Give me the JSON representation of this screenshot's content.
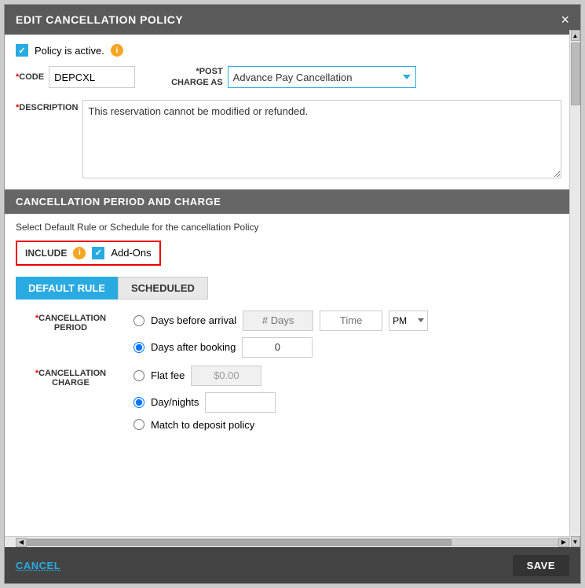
{
  "dialog": {
    "title": "EDIT CANCELLATION POLICY",
    "close_label": "×"
  },
  "form": {
    "policy_active_label": "Policy is active.",
    "code_label": "*CODE",
    "code_value": "DEPCXL",
    "post_charge_label": "*POST\nCHARGE AS",
    "post_charge_value": "Advance Pay Cancellation",
    "description_label": "*DESCRIPTION",
    "description_value": "This reservation cannot be modified or refunded."
  },
  "section": {
    "title": "CANCELLATION PERIOD AND CHARGE",
    "select_rule_text": "Select Default Rule or Schedule for the cancellation Policy",
    "include_label": "INCLUDE",
    "addons_label": "Add-Ons"
  },
  "tabs": {
    "default_rule": "DEFAULT RULE",
    "scheduled": "SCHEDULED"
  },
  "cancellation_period": {
    "label": "*CANCELLATION\nPERIOD",
    "radio1_label": "Days before arrival",
    "days_placeholder": "# Days",
    "time_placeholder": "Time",
    "ampm_value": "PM",
    "radio2_label": "Days after booking",
    "days_value": "0"
  },
  "cancellation_charge": {
    "label": "*CANCELLATION\nCHARGE",
    "radio1_label": "Flat fee",
    "flat_fee_value": "$0.00",
    "radio2_label": "Day/nights",
    "daynights_value": "",
    "radio3_label": "Match to deposit policy"
  },
  "footer": {
    "cancel_label": "CANCEL",
    "save_label": "SAVE"
  }
}
